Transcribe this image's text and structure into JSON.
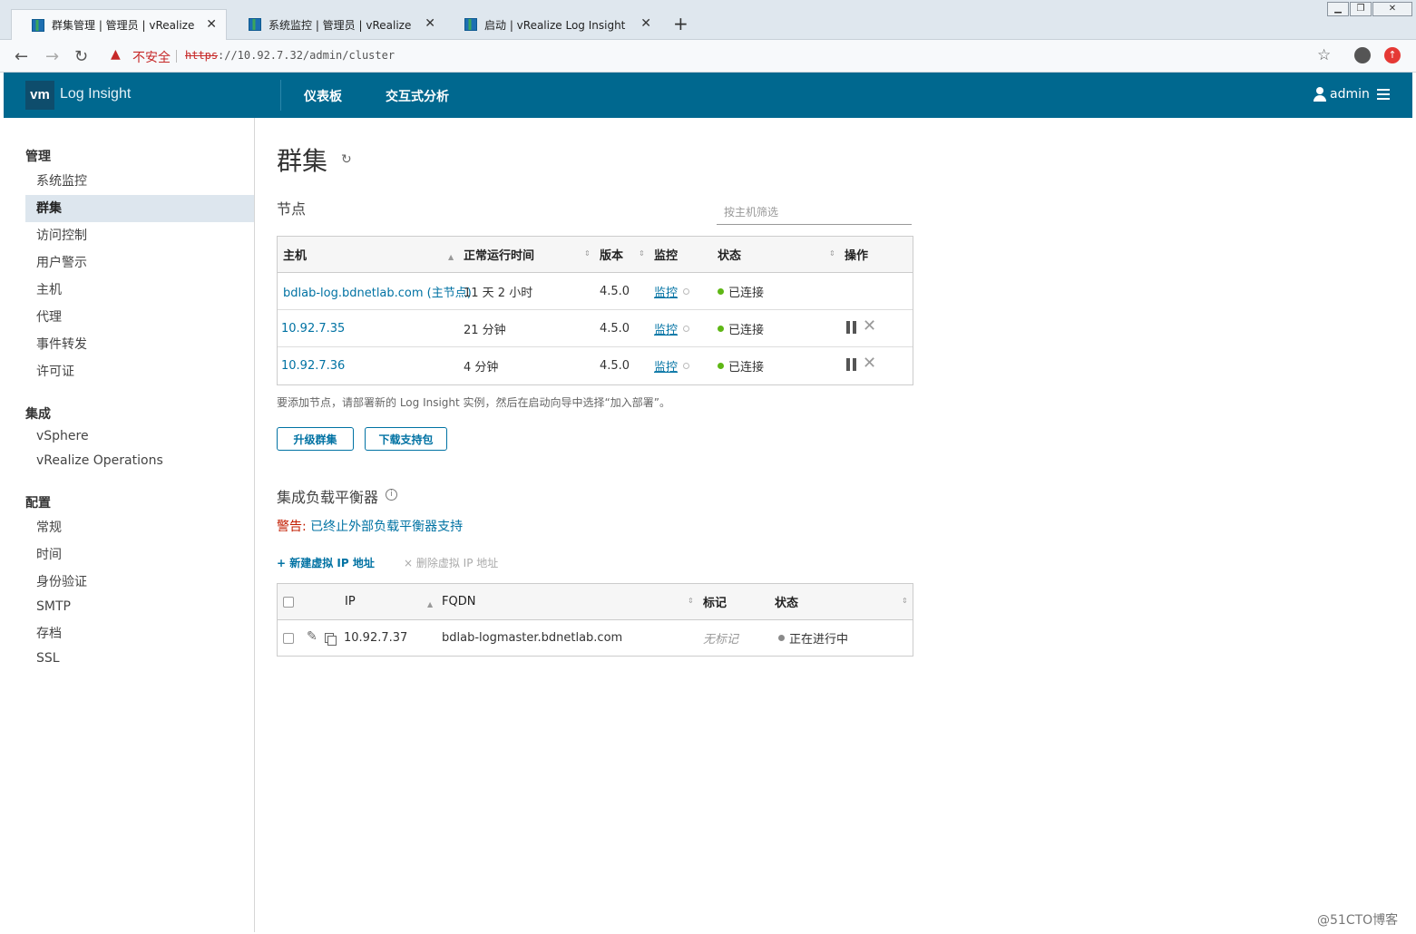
{
  "browser": {
    "tabs": [
      {
        "title": "群集管理 | 管理员 | vRealize",
        "active": true
      },
      {
        "title": "系统监控 | 管理员 | vRealize",
        "active": false
      },
      {
        "title": "启动 | vRealize Log Insight",
        "active": false
      }
    ],
    "new_tab": "+",
    "security_label": "不安全",
    "url_scheme": "https",
    "url_rest": "://10.92.7.32/admin/cluster"
  },
  "header": {
    "logo": "vm",
    "product": "Log Insight",
    "nav": [
      "仪表板",
      "交互式分析"
    ],
    "user": "admin"
  },
  "sidebar": {
    "sections": [
      {
        "title": "管理",
        "items": [
          "系统监控",
          "群集",
          "访问控制",
          "用户警示",
          "主机",
          "代理",
          "事件转发",
          "许可证"
        ]
      },
      {
        "title": "集成",
        "items": [
          "vSphere",
          "vRealize Operations"
        ]
      },
      {
        "title": "配置",
        "items": [
          "常规",
          "时间",
          "身份验证",
          "SMTP",
          "存档",
          "SSL"
        ]
      }
    ],
    "active": "群集"
  },
  "main": {
    "title": "群集",
    "nodes_title": "节点",
    "filter_placeholder": "按主机筛选",
    "nodes_columns": [
      "主机",
      "正常运行时间",
      "版本",
      "监控",
      "状态",
      "操作"
    ],
    "nodes": [
      {
        "host": "bdlab-log.bdnetlab.com (主节点)",
        "uptime": "11 天 2 小时",
        "version": "4.5.0",
        "monitor": "监控",
        "status": "已连接"
      },
      {
        "host": "10.92.7.35",
        "uptime": "21 分钟",
        "version": "4.5.0",
        "monitor": "监控",
        "status": "已连接"
      },
      {
        "host": "10.92.7.36",
        "uptime": "4 分钟",
        "version": "4.5.0",
        "monitor": "监控",
        "status": "已连接"
      }
    ],
    "hint": "要添加节点，请部署新的 Log Insight 实例，然后在启动向导中选择“加入部署”。",
    "buttons": {
      "upgrade": "升级群集",
      "download": "下载支持包"
    },
    "lb_title": "集成负载平衡器",
    "warn_label": "警告:",
    "warn_text": "已终止外部负载平衡器支持",
    "add_vip": "+ 新建虚拟 IP 地址",
    "del_vip": "× 删除虚拟 IP 地址",
    "lb_columns": [
      "IP",
      "FQDN",
      "标记",
      "状态"
    ],
    "lb_rows": [
      {
        "ip": "10.92.7.37",
        "fqdn": "bdlab-logmaster.bdnetlab.com",
        "tag": "无标记",
        "status": "正在进行中"
      }
    ]
  },
  "watermark": "@51CTO博客",
  "colors": {
    "header_bg": "#00688f",
    "link": "#0072a3",
    "warn": "#c21d00",
    "connected": "#5eb715"
  }
}
